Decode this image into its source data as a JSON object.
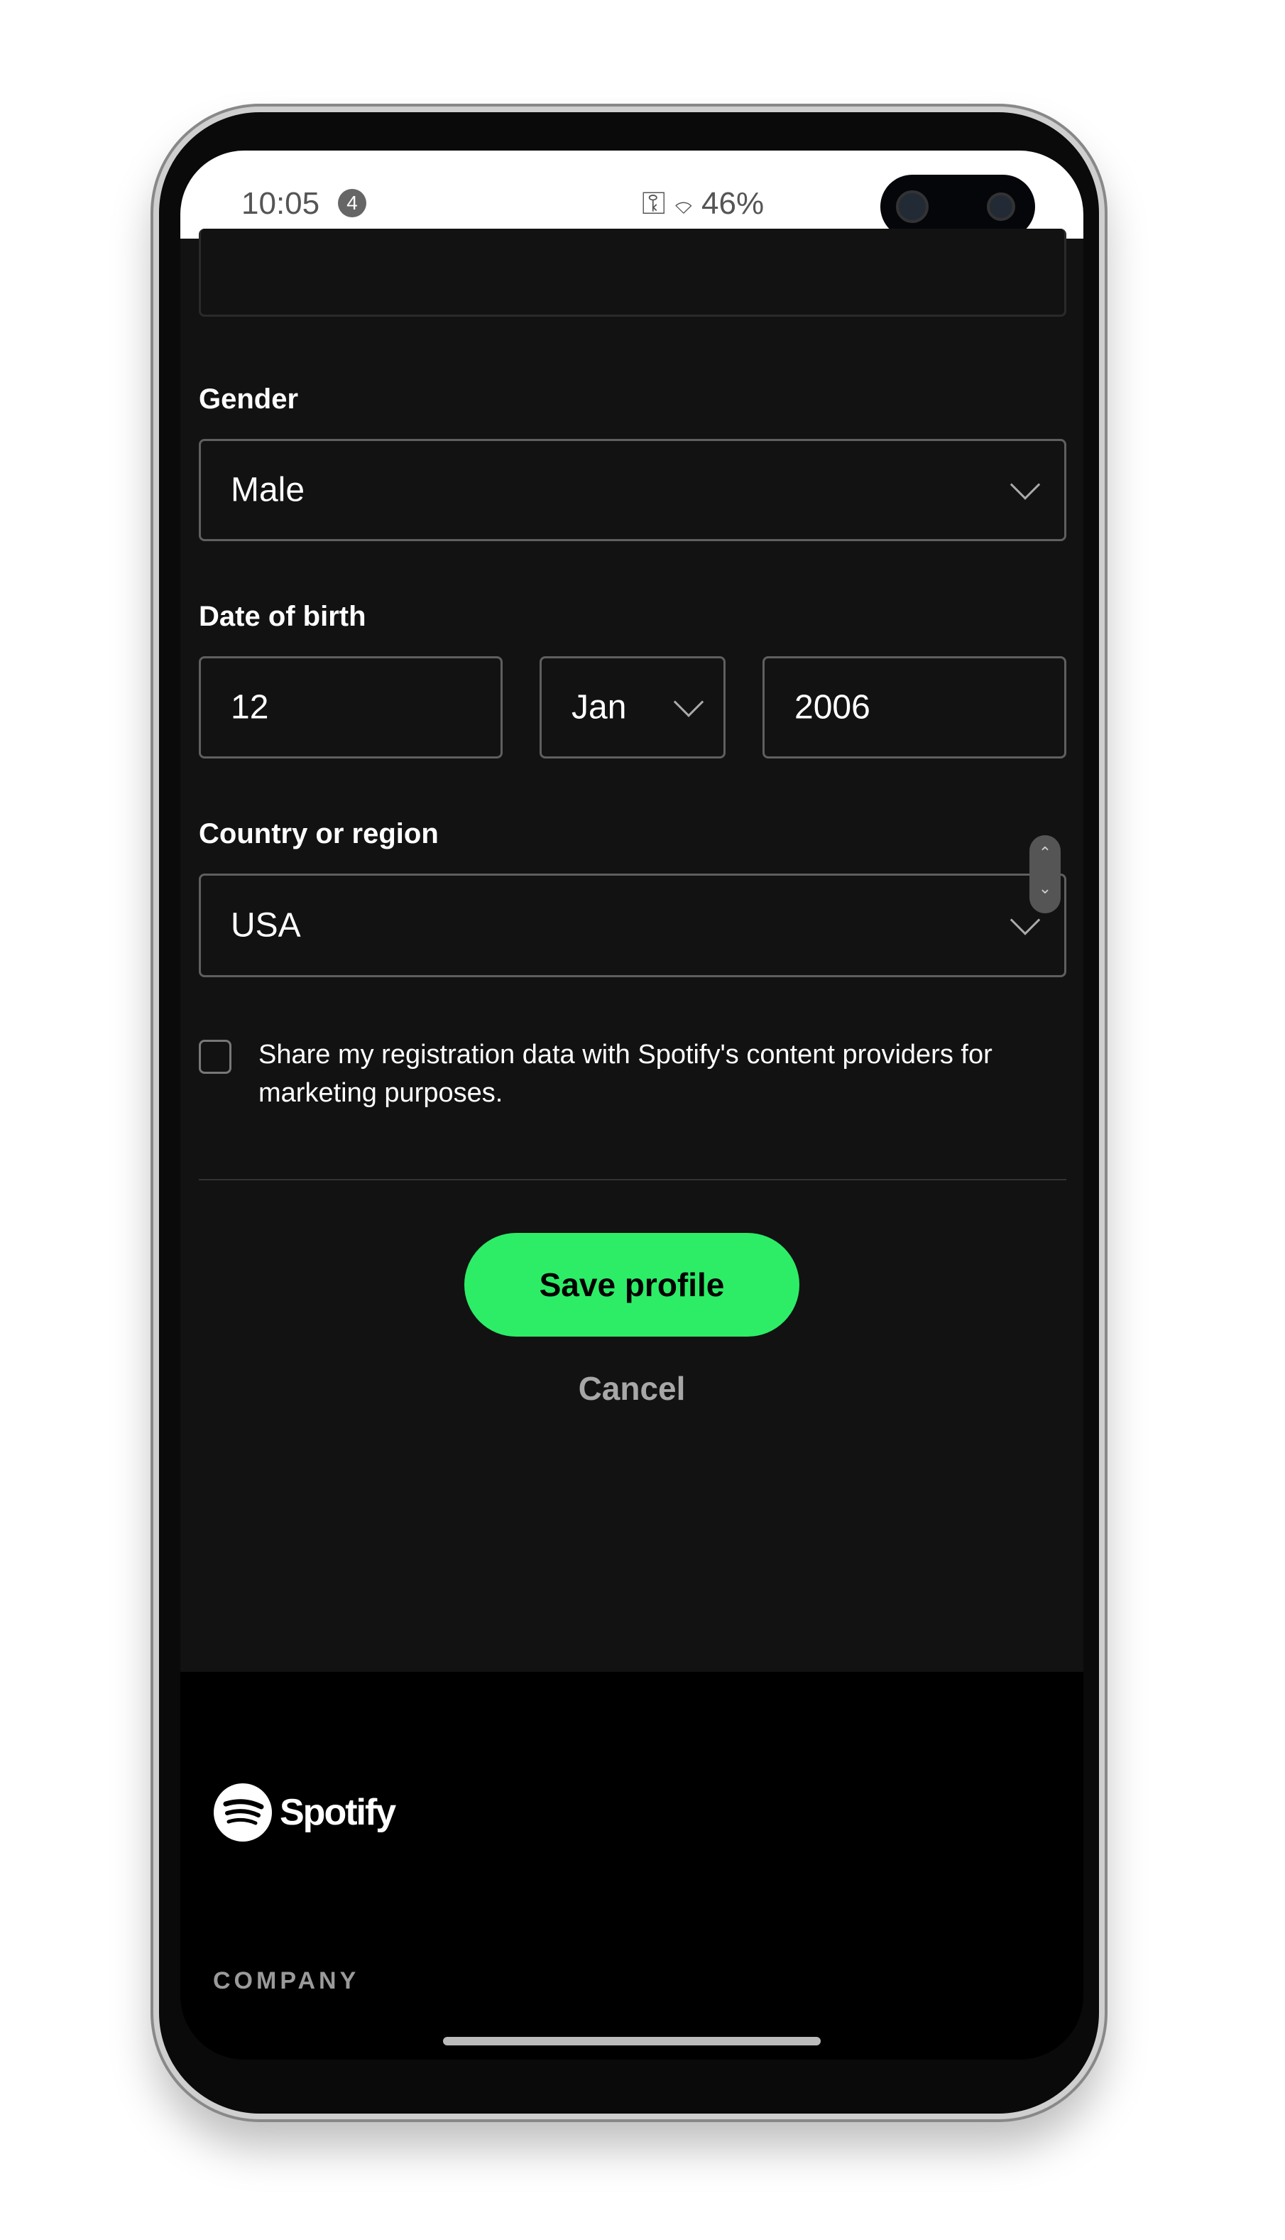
{
  "status_bar": {
    "time": "10:05",
    "notification_count": "4",
    "battery": "46%",
    "icons": [
      "key-icon",
      "wifi-icon"
    ]
  },
  "form": {
    "gender": {
      "label": "Gender",
      "value": "Male"
    },
    "dob": {
      "label": "Date of birth",
      "day": "12",
      "month": "Jan",
      "year": "2006"
    },
    "country": {
      "label": "Country or region",
      "value": "USA"
    },
    "share_checkbox": {
      "label": "Share my registration data with Spotify's content providers for marketing purposes.",
      "checked": false
    },
    "save_label": "Save profile",
    "cancel_label": "Cancel"
  },
  "footer": {
    "logo_text": "Spotify",
    "section_heading": "COMPANY"
  },
  "colors": {
    "accent": "#2ded67",
    "background": "#121212",
    "footer": "#000000"
  }
}
